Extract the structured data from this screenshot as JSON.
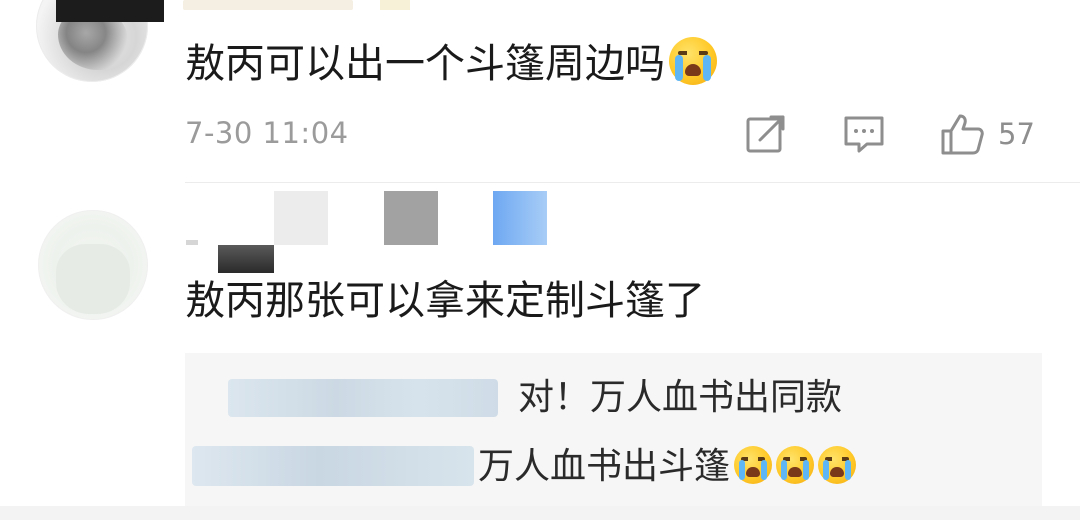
{
  "comments": [
    {
      "text": "敖丙可以出一个斗篷周边吗",
      "timestamp": "7-30 11:04",
      "likes": "57",
      "emoji": "loudly-crying-face"
    },
    {
      "text": "敖丙那张可以拿来定制斗篷了",
      "replies": [
        {
          "text": "对！万人血书出同款"
        },
        {
          "text": "万人血书出斗篷",
          "emoji_count": 3,
          "emoji": "loudly-crying-face"
        }
      ]
    }
  ],
  "icons": {
    "share": "share-icon",
    "reply": "comment-icon",
    "like": "thumbs-up-icon"
  },
  "colors": {
    "text": "#1a1a1a",
    "meta": "#9b9b9b",
    "reply_bg": "#f6f6f6"
  }
}
